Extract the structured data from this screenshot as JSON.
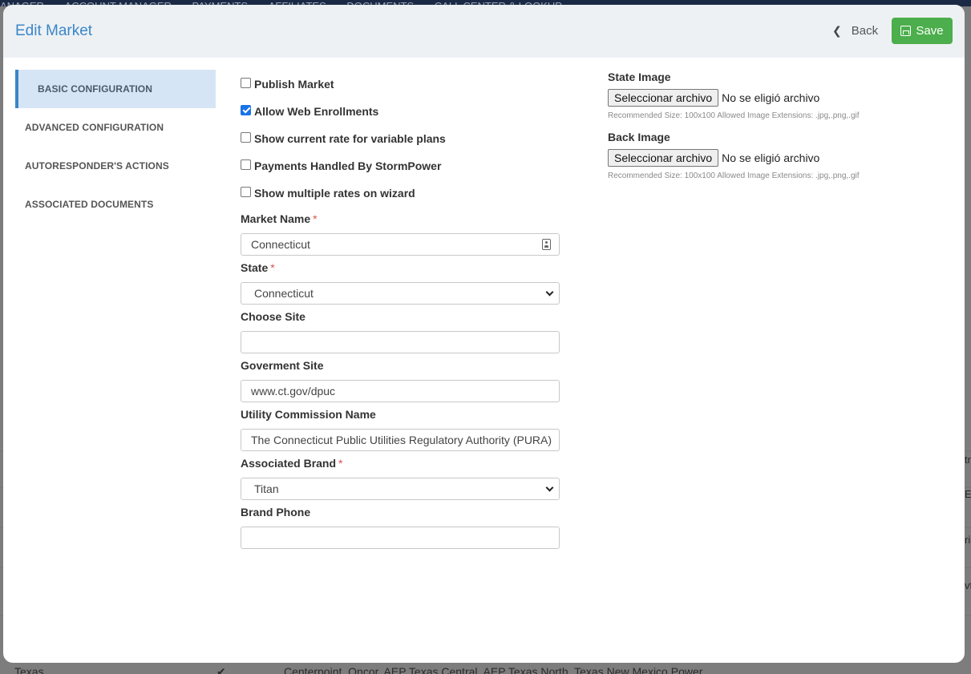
{
  "background": {
    "nav_items": [
      "ANAGER",
      "ACCOUNT MANAGER",
      "PAYMENTS",
      "AFFILIATES",
      "DOCUMENTS",
      "CALL CENTER & LOOKUP"
    ],
    "bottom_row": {
      "state": "Texas",
      "check": "✔",
      "utilities": "Centerpoint, Oncor, AEP Texas Central, AEP Texas North, Texas New Mexico Power"
    },
    "right_fragments": [
      "tr",
      "E",
      "ri",
      "vt"
    ]
  },
  "modal": {
    "title": "Edit Market",
    "back_label": "Back",
    "save_label": "Save"
  },
  "sidebar": {
    "items": [
      {
        "label": "BASIC CONFIGURATION",
        "active": true
      },
      {
        "label": "ADVANCED CONFIGURATION",
        "active": false
      },
      {
        "label": "AUTORESPONDER'S ACTIONS",
        "active": false
      },
      {
        "label": "ASSOCIATED DOCUMENTS",
        "active": false
      }
    ]
  },
  "form": {
    "checkboxes": [
      {
        "label": "Publish Market",
        "checked": false
      },
      {
        "label": "Allow Web Enrollments",
        "checked": true
      },
      {
        "label": "Show current rate for variable plans",
        "checked": false
      },
      {
        "label": "Payments Handled By StormPower",
        "checked": false
      },
      {
        "label": "Show multiple rates on wizard",
        "checked": false
      }
    ],
    "market_name": {
      "label": "Market Name",
      "required": "*",
      "value": "Connecticut"
    },
    "state": {
      "label": "State",
      "required": "*",
      "value": "Connecticut"
    },
    "choose_site": {
      "label": "Choose Site",
      "value": ""
    },
    "government_site": {
      "label": "Goverment Site",
      "value": "www.ct.gov/dpuc"
    },
    "utility_commission": {
      "label": "Utility Commission Name",
      "value": "The Connecticut Public Utilities Regulatory Authority (PURA)"
    },
    "associated_brand": {
      "label": "Associated Brand",
      "required": "*",
      "value": "Titan"
    },
    "brand_phone": {
      "label": "Brand Phone",
      "value": ""
    }
  },
  "images": {
    "state_image": {
      "label": "State Image",
      "button": "Seleccionar archivo",
      "status": "No se eligió archivo",
      "hint": "Recommended Size: 100x100 Allowed Image Extensions: .jpg,.png,.gif"
    },
    "back_image": {
      "label": "Back Image",
      "button": "Seleccionar archivo",
      "status": "No se eligió archivo",
      "hint": "Recommended Size: 100x100 Allowed Image Extensions: .jpg,.png,.gif"
    }
  },
  "colors": {
    "accent": "#3a86c8",
    "save_button": "#4cae4c",
    "required": "#d9534f",
    "checkbox_checked": "#1a73e8"
  }
}
